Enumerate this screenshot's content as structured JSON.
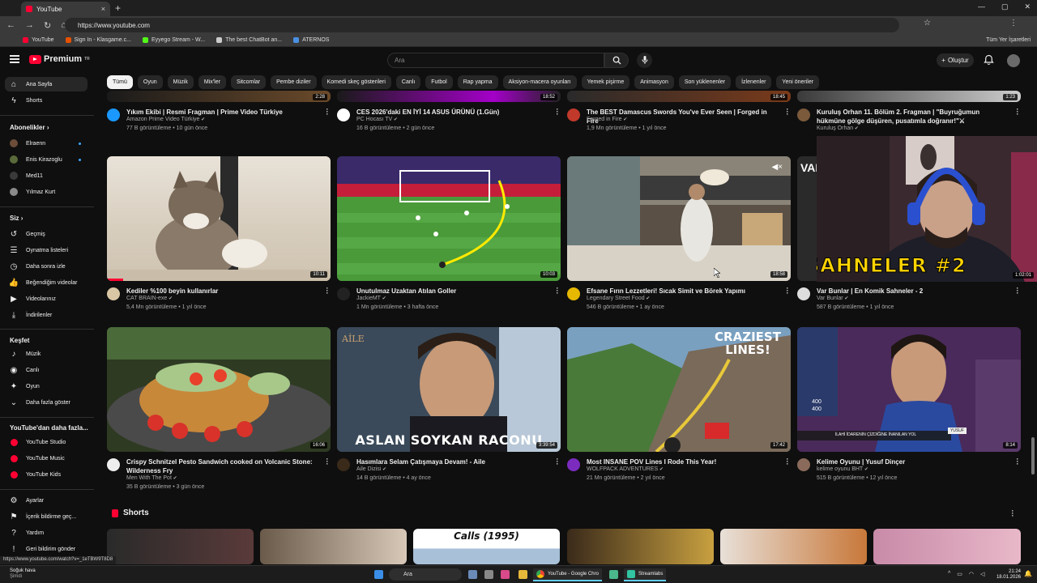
{
  "browser": {
    "tab_title": "YouTube",
    "url": "https://www.youtube.com",
    "bookmarks": [
      {
        "label": "YouTube",
        "color": "#ff0033"
      },
      {
        "label": "Sign In - Klasgame.c...",
        "color": "#e65100"
      },
      {
        "label": "Eyyego Stream - W...",
        "color": "#53fc18"
      },
      {
        "label": "The best ChatBot an...",
        "color": "#cccccc"
      },
      {
        "label": "ATERNOS",
        "color": "#4a90e2"
      }
    ],
    "all_bookmarks": "Tüm Yer İşaretleri"
  },
  "header": {
    "logo_text": "Premium",
    "logo_sup": "TR",
    "search_placeholder": "Ara",
    "create_label": "Oluştur"
  },
  "chips": [
    "Tümü",
    "Oyun",
    "Müzik",
    "Mix'ler",
    "Sitcomlar",
    "Pembe diziler",
    "Komedi skeç gösterileri",
    "Canlı",
    "Futbol",
    "Rap yapma",
    "Aksiyon-macera oyunları",
    "Yemek pişirme",
    "Animasyon",
    "Son yüklenenler",
    "İzlenenler",
    "Yeni öneriler"
  ],
  "sidebar": {
    "main": [
      {
        "label": "Ana Sayfa",
        "icon": "home-icon"
      },
      {
        "label": "Shorts",
        "icon": "shorts-icon"
      }
    ],
    "subs_title": "Abonelikler",
    "subs": [
      {
        "label": "Elraenn",
        "color": "#6b4d3a",
        "dot": true
      },
      {
        "label": "Enis Kirazoglu",
        "color": "#5a6a3a",
        "dot": true
      },
      {
        "label": "Med11",
        "color": "#3a3a3a",
        "dot": false
      },
      {
        "label": "Yılmaz Kurt",
        "color": "#8a8a8a",
        "dot": false
      }
    ],
    "you_title": "Siz",
    "you": [
      {
        "label": "Geçmiş",
        "icon": "history-icon",
        "glyph": "↺"
      },
      {
        "label": "Oynatma listeleri",
        "icon": "playlist-icon",
        "glyph": "☰"
      },
      {
        "label": "Daha sonra izle",
        "icon": "clock-icon",
        "glyph": "◷"
      },
      {
        "label": "Beğendiğim videolar",
        "icon": "like-icon",
        "glyph": "👍"
      },
      {
        "label": "Videolarınız",
        "icon": "video-icon",
        "glyph": "▶"
      },
      {
        "label": "İndirilenler",
        "icon": "download-icon",
        "glyph": "⤓"
      }
    ],
    "explore_title": "Keşfet",
    "explore": [
      {
        "label": "Müzik",
        "icon": "music-icon",
        "glyph": "♪"
      },
      {
        "label": "Canlı",
        "icon": "live-icon",
        "glyph": "◉"
      },
      {
        "label": "Oyun",
        "icon": "gaming-icon",
        "glyph": "✦"
      },
      {
        "label": "Daha fazla göster",
        "icon": "chevron-down-icon",
        "glyph": "⌄"
      }
    ],
    "more_title": "YouTube'dan daha fazla...",
    "more": [
      "YouTube Studio",
      "YouTube Music",
      "YouTube Kids"
    ],
    "bottom": [
      {
        "label": "Ayarlar",
        "icon": "gear-icon",
        "glyph": "⚙"
      },
      {
        "label": "İçerik bildirme geç...",
        "icon": "flag-icon",
        "glyph": "⚑"
      },
      {
        "label": "Yardım",
        "icon": "help-icon",
        "glyph": "?"
      },
      {
        "label": "Geri bildirim gönder",
        "icon": "feedback-icon",
        "glyph": "!"
      }
    ]
  },
  "top_row": [
    {
      "title": "Yıkım Ekibi | Resmi Fragman | Prime Video Türkiye",
      "channel": "Amazon Prime Video Türkiye",
      "meta": "77 B görüntüleme • 10 gün önce",
      "duration": "2:28",
      "av": "#1a98ff"
    },
    {
      "title": "CES 2026'daki EN İYİ 14 ASUS ÜRÜNÜ (1.Gün)",
      "channel": "PC Hocası TV",
      "meta": "16 B görüntüleme • 2 gün önce",
      "duration": "18:52",
      "av": "#ffffff"
    },
    {
      "title": "The BEST Damascus Swords You've Ever Seen | Forged in Fire",
      "channel": "Forged in Fire",
      "meta": "1,9 Mn görüntüleme • 1 yıl önce",
      "duration": "18:45",
      "av": "#c0392b"
    },
    {
      "title": "Kuruluş Orhan 11. Bölüm 2. Fragman | \"Buyruğumun hükmüne gölge düşüren, pusatımla doğranır!\"⚔",
      "channel": "Kuruluş Orhan",
      "meta": "",
      "duration": "1:23",
      "av": "#7a5a3a"
    }
  ],
  "row2": [
    {
      "title": "Kediler %100 beyin kullanırlar",
      "channel": "CAT BRAIN-exe",
      "meta": "5,4 Mn görüntüleme • 1 yıl önce",
      "duration": "10:11",
      "av": "#d9c6a5"
    },
    {
      "title": "Unutulmaz Uzaktan Atılan Goller",
      "channel": "JackieMT",
      "meta": "1 Mn görüntüleme • 3 hafta önce",
      "duration": "10:03",
      "av": "#222222"
    },
    {
      "title": "Efsane Fırın Lezzetleri! Sıcak Simit ve Börek Yapımı",
      "channel": "Legendary Street Food",
      "meta": "546 B görüntüleme • 1 ay önce",
      "duration": "18:58",
      "av": "#e6b800"
    },
    {
      "title": "Var Bunlar | En Komik Sahneler - 2",
      "channel": "Var Bunlar",
      "meta": "587 B görüntüleme • 1 yıl önce",
      "duration": "1:02:01",
      "av": "#dddddd"
    }
  ],
  "row3": [
    {
      "title": "Crispy Schnitzel Pesto Sandwich cooked on Volcanic Stone: Wilderness Fry",
      "channel": "Men With The Pot",
      "meta": "35 B görüntüleme • 3 gün önce",
      "duration": "16:06",
      "av": "#eeeeee"
    },
    {
      "title": "Hasımlara Selam Çatışmaya Devam! - Aile",
      "channel": "Aile Dizisi",
      "meta": "14 B görüntüleme • 4 ay önce",
      "duration": "3:39:54",
      "av": "#3a2a1a"
    },
    {
      "title": "Most INSANE POV Lines I Rode This Year!",
      "channel": "WOLFPACK ADVENTURES",
      "meta": "21 Mn görüntüleme • 2 yıl önce",
      "duration": "17:42",
      "av": "#7b2cbf"
    },
    {
      "title": "Kelime Oyunu | Yusuf Dinçer",
      "channel": "kelime oyunu BHT",
      "meta": "515 B görüntüleme • 12 yıl önce",
      "duration": "8:14",
      "av": "#8a6a5a"
    }
  ],
  "thumb_text": {
    "aile_title": "ASLAN SOYKAN RACONU",
    "pov_title": "CRAZIEST LINES!",
    "comedy_title": "SAHNELER #2",
    "comedy_prefix": "VAR",
    "kelime_caption": "İLAHİ İDARENİN ÇİZDİĞİNE İNANILAN YOL",
    "kelime_name": "YUSUF",
    "kelime_score_a": "400",
    "kelime_score_b": "400",
    "aile_logo": "AİLE"
  },
  "shorts": {
    "title": "Shorts",
    "first_caption": "Calls (1995)"
  },
  "status_url": "https://www.youtube.com/watch?v=_1eTBW9T8D8",
  "taskbar": {
    "weather_line1": "Soğuk hava",
    "weather_line2": "Şimdi",
    "search": "Ara",
    "chrome_label": "YouTube - Google Chro",
    "streamlabs_label": "Streamlabs",
    "time": "21:24",
    "date": "18.01.2026"
  }
}
